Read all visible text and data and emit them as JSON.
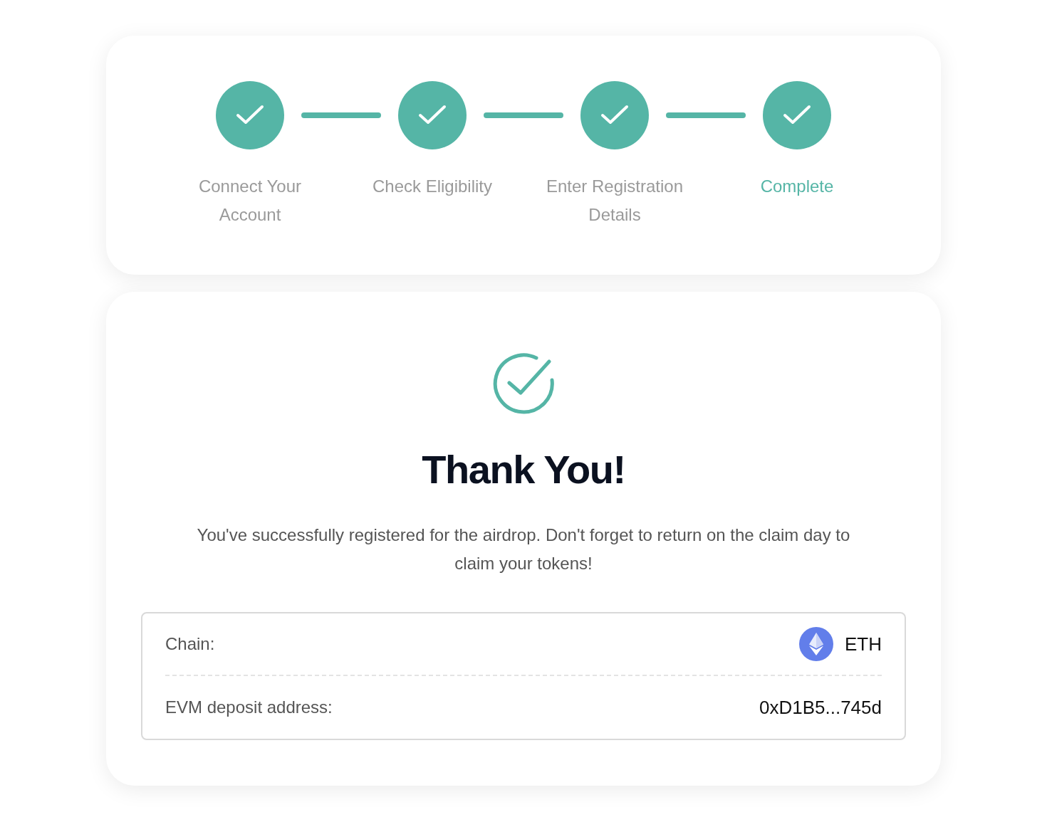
{
  "steps": [
    {
      "label": "Connect Your Account",
      "completed": true,
      "current": false
    },
    {
      "label": "Check Eligibility",
      "completed": true,
      "current": false
    },
    {
      "label": "Enter Registration Details",
      "completed": true,
      "current": false
    },
    {
      "label": "Complete",
      "completed": true,
      "current": true
    }
  ],
  "confirmation": {
    "title": "Thank You!",
    "message": "You've successfully registered for the airdrop. Don't forget to return on the claim day to claim your tokens!"
  },
  "details": [
    {
      "label": "Chain:",
      "value": "ETH",
      "kind": "chain"
    },
    {
      "label": "EVM deposit address:",
      "value": "0xD1B5...745d",
      "kind": "text"
    }
  ]
}
